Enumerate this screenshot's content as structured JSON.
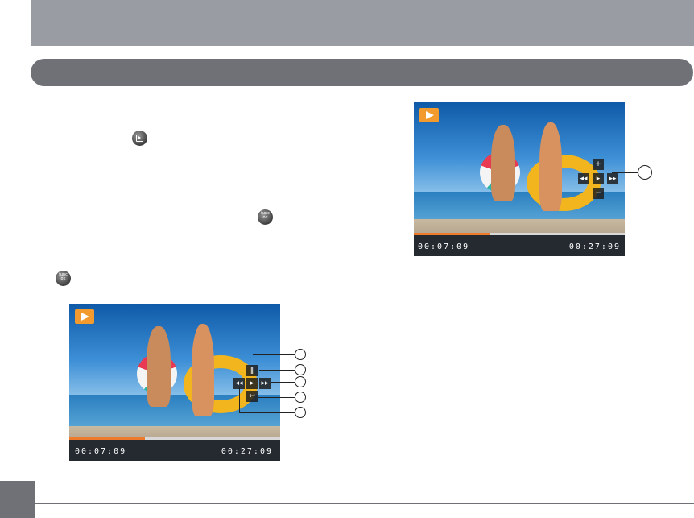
{
  "header": {
    "title": ""
  },
  "section": {
    "title": ""
  },
  "inline_buttons": {
    "play_button_icon": "playback-button-icon",
    "func_ok_label": "func\nok"
  },
  "screen_main": {
    "mode_icon": "play-mode-icon",
    "elapsed_time": "00:07:09",
    "total_time": "00:27:09",
    "progress": 0.36,
    "controls": [
      "volume-up-icon",
      "rewind-icon",
      "play-icon",
      "fast-forward-icon",
      "volume-down-icon"
    ]
  },
  "screen_detail": {
    "mode_icon": "play-mode-icon",
    "elapsed_time": "00:07:09",
    "total_time": "00:27:09",
    "progress": 0.36,
    "controls": [
      "pause-icon",
      "rewind-icon",
      "play-icon",
      "fast-forward-icon",
      "return-icon"
    ]
  },
  "colors": {
    "accent": "#ee7a2b",
    "bar": "#6f7177",
    "header": "#999da3"
  }
}
